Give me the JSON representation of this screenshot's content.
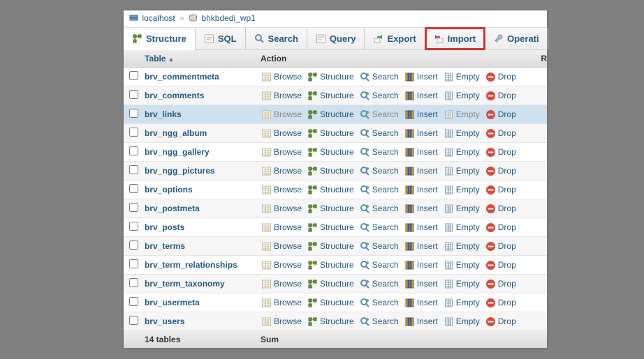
{
  "breadcrumb": {
    "host": "localhost",
    "db": "bhkbdedi_wp1"
  },
  "tabs": {
    "structure": "Structure",
    "sql": "SQL",
    "search": "Search",
    "query": "Query",
    "export": "Export",
    "import": "Import",
    "operations": "Operati"
  },
  "headers": {
    "table": "Table",
    "action": "Action",
    "rows": "R"
  },
  "action_labels": {
    "browse": "Browse",
    "structure": "Structure",
    "search": "Search",
    "insert": "Insert",
    "empty": "Empty",
    "drop": "Drop"
  },
  "tables": [
    {
      "name": "brv_commentmeta",
      "row_state": "even"
    },
    {
      "name": "brv_comments",
      "row_state": "odd"
    },
    {
      "name": "brv_links",
      "row_state": "hover"
    },
    {
      "name": "brv_ngg_album",
      "row_state": "odd"
    },
    {
      "name": "brv_ngg_gallery",
      "row_state": "even"
    },
    {
      "name": "brv_ngg_pictures",
      "row_state": "odd"
    },
    {
      "name": "brv_options",
      "row_state": "even"
    },
    {
      "name": "brv_postmeta",
      "row_state": "odd"
    },
    {
      "name": "brv_posts",
      "row_state": "even"
    },
    {
      "name": "brv_terms",
      "row_state": "odd"
    },
    {
      "name": "brv_term_relationships",
      "row_state": "even"
    },
    {
      "name": "brv_term_taxonomy",
      "row_state": "odd"
    },
    {
      "name": "brv_usermeta",
      "row_state": "even"
    },
    {
      "name": "brv_users",
      "row_state": "odd"
    }
  ],
  "summary": {
    "count_label": "14 tables",
    "sum_label": "Sum"
  }
}
